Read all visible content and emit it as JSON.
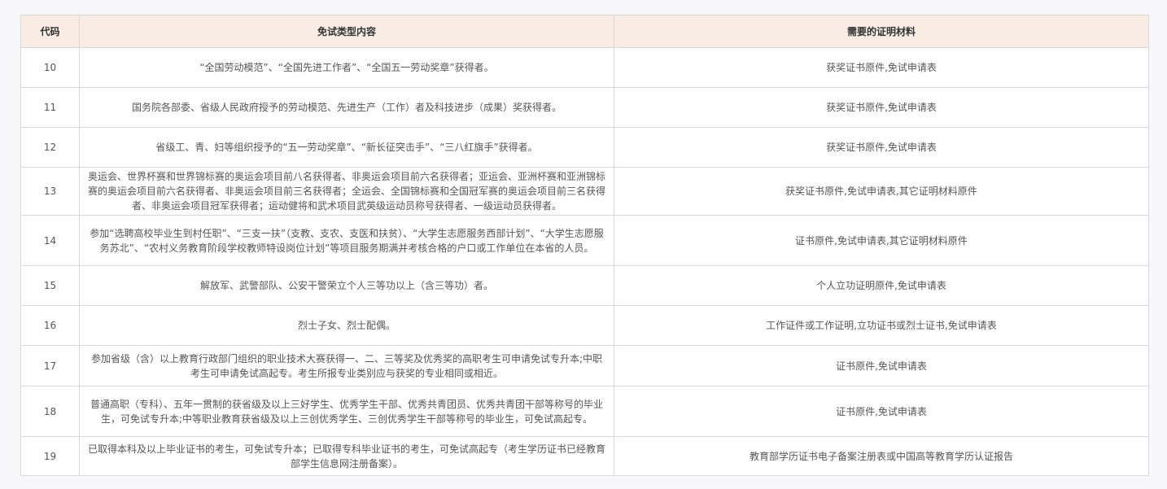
{
  "table": {
    "headers": [
      "代码",
      "免试类型内容",
      "需要的证明材料"
    ],
    "rows": [
      {
        "code": "10",
        "content": "“全国劳动模范”、“全国先进工作者”、“全国五一劳动奖章”获得者。",
        "materials": "获奖证书原件,免试申请表"
      },
      {
        "code": "11",
        "content": "国务院各部委、省级人民政府授予的劳动模范、先进生产（工作）者及科技进步（成果）奖获得者。",
        "materials": "获奖证书原件,免试申请表"
      },
      {
        "code": "12",
        "content": "省级工、青、妇等组织授予的“五一劳动奖章”、“新长征突击手”、“三八红旗手”获得者。",
        "materials": "获奖证书原件,免试申请表"
      },
      {
        "code": "13",
        "content": "奥运会、世界杯赛和世界锦标赛的奥运会项目前八名获得者、非奥运会项目前六名获得者；亚运会、亚洲杯赛和亚洲锦标赛的奥运会项目前六名获得者、非奥运会项目前三名获得者；全运会、全国锦标赛和全国冠军赛的奥运会项目前三名获得者、非奥运会项目冠军获得者；运动健将和武术项目武英级运动员称号获得者、一级运动员获得者。",
        "materials": "获奖证书原件,免试申请表,其它证明材料原件"
      },
      {
        "code": "14",
        "content": "参加“选聘高校毕业生到村任职”、“三支一扶”（支教、支农、支医和扶贫）、“大学生志愿服务西部计划”、“大学生志愿服务苏北”、“农村义务教育阶段学校教师特设岗位计划”等项目服务期满并考核合格的户口或工作单位在本省的人员。",
        "materials": "证书原件,免试申请表,其它证明材料原件"
      },
      {
        "code": "15",
        "content": "解放军、武警部队、公安干警荣立个人三等功以上（含三等功）者。",
        "materials": "个人立功证明原件,免试申请表"
      },
      {
        "code": "16",
        "content": "烈士子女、烈士配偶。",
        "materials": "工作证件或工作证明,立功证书或烈士证书,免试申请表"
      },
      {
        "code": "17",
        "content": "参加省级（含）以上教育行政部门组织的职业技术大赛获得一、二、三等奖及优秀奖的高职考生可申请免试专升本;中职考生可申请免试高起专。考生所报专业类别应与获奖的专业相同或相近。",
        "materials": "证书原件,免试申请表"
      },
      {
        "code": "18",
        "content": "普通高职（专科）、五年一贯制的获省级及以上三好学生、优秀学生干部、优秀共青团员、优秀共青团干部等称号的毕业生，可免试专升本;中等职业教育获省级及以上三创优秀学生、三创优秀学生干部等称号的毕业生，可免试高起专。",
        "materials": "证书原件,免试申请表"
      },
      {
        "code": "19",
        "content": "已取得本科及以上毕业证书的考生，可免试专升本；已取得专科毕业证书的考生，可免试高起专（考生学历证书已经教育部学生信息网注册备案）。",
        "materials": "教育部学历证书电子备案注册表或中国高等教育学历认证报告"
      }
    ]
  }
}
